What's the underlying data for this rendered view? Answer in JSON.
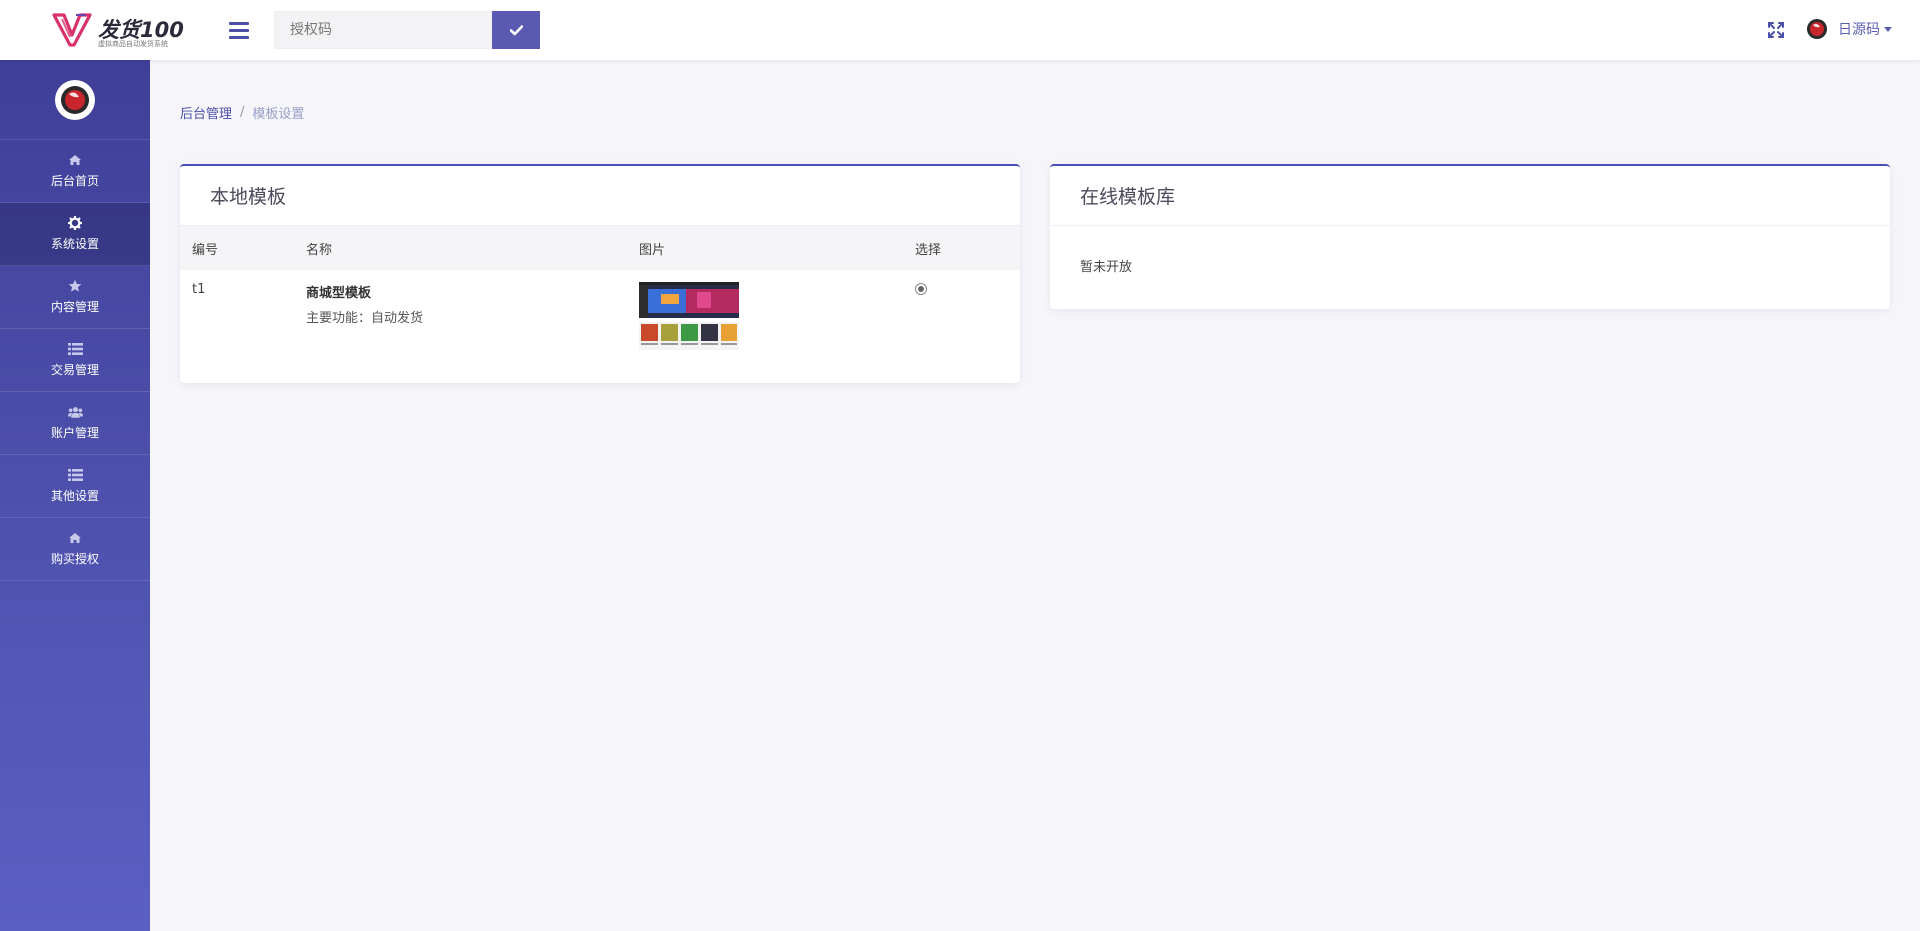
{
  "header": {
    "logo_text": "发货100",
    "logo_subtitle": "虚拟商品自动发货系统",
    "search": {
      "placeholder": "授权码",
      "value": ""
    },
    "user": {
      "name": "日源码"
    }
  },
  "sidebar": {
    "items": [
      {
        "label": "后台首页",
        "icon": "home-icon",
        "active": false
      },
      {
        "label": "系统设置",
        "icon": "gear-icon",
        "active": true
      },
      {
        "label": "内容管理",
        "icon": "star-icon",
        "active": false
      },
      {
        "label": "交易管理",
        "icon": "list-icon",
        "active": false
      },
      {
        "label": "账户管理",
        "icon": "users-icon",
        "active": false
      },
      {
        "label": "其他设置",
        "icon": "list-icon",
        "active": false
      },
      {
        "label": "购买授权",
        "icon": "home-icon",
        "active": false
      }
    ]
  },
  "breadcrumb": {
    "parent": "后台管理",
    "separator": "/",
    "current": "模板设置"
  },
  "local_templates": {
    "title": "本地模板",
    "columns": [
      "编号",
      "名称",
      "图片",
      "选择"
    ],
    "rows": [
      {
        "id": "t1",
        "name": "商城型模板",
        "desc": "主要功能：自动发货",
        "selected": true
      }
    ]
  },
  "online_templates": {
    "title": "在线模板库",
    "message": "暂未开放"
  },
  "colors": {
    "accent": "#4b4fa6",
    "button": "#5a5ab3",
    "sidebar_top": "#3f3f99",
    "sidebar_bottom": "#5a5fc2",
    "background": "#f6f6fa"
  }
}
